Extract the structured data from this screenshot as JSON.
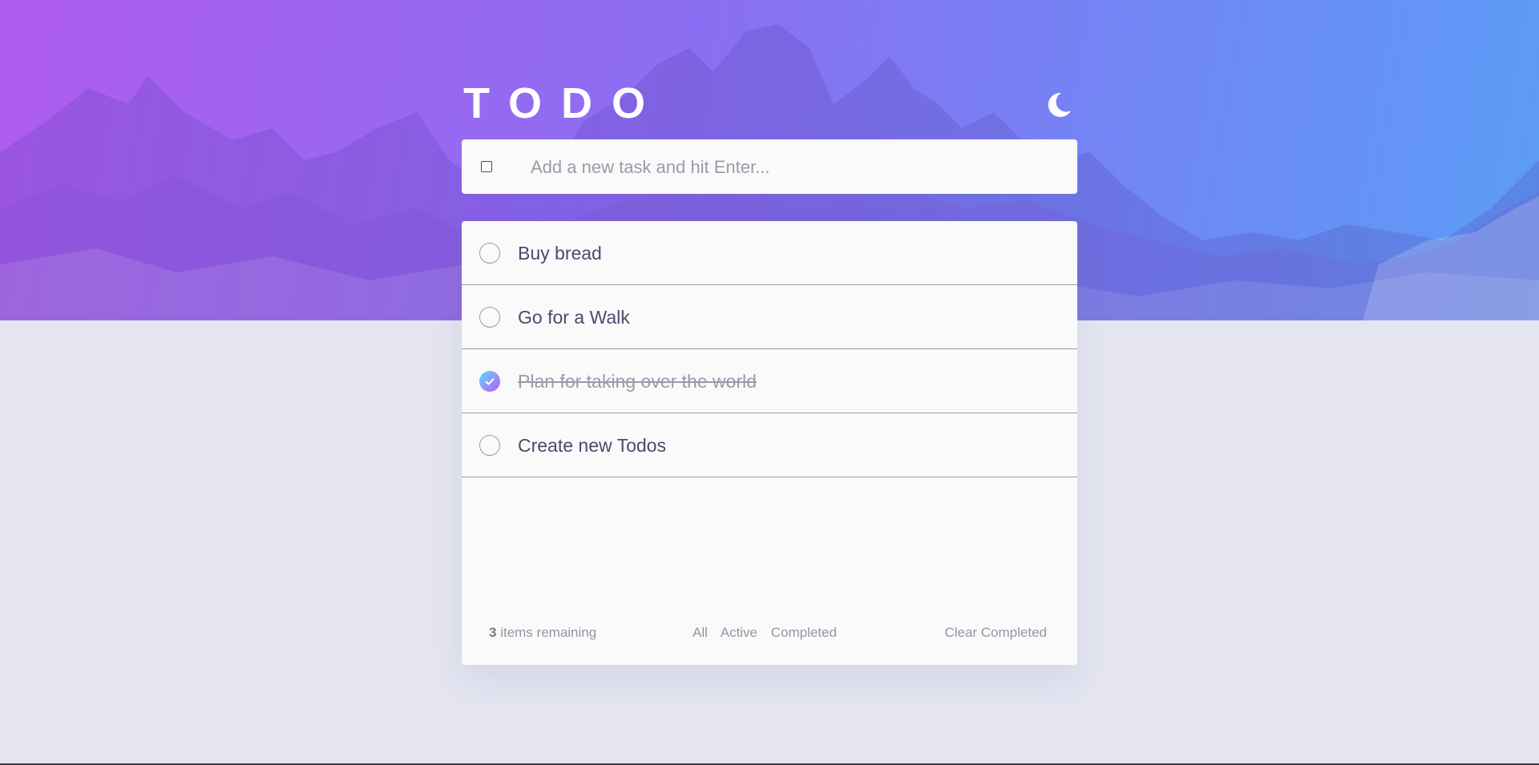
{
  "app": {
    "title": "TODO",
    "theme_toggle_icon": "moon-icon"
  },
  "new_task": {
    "placeholder": "Add a new task and hit Enter...",
    "value": ""
  },
  "todos": [
    {
      "text": "Buy bread",
      "completed": false
    },
    {
      "text": "Go for a Walk",
      "completed": false
    },
    {
      "text": "Plan for taking over the world",
      "completed": true
    },
    {
      "text": "Create new Todos",
      "completed": false
    }
  ],
  "footer": {
    "remaining_count": "3",
    "remaining_label": "items remaining",
    "filters": [
      "All",
      "Active",
      "Completed"
    ],
    "clear_label": "Clear Completed"
  },
  "colors": {
    "gradient_start": "#57ddff",
    "gradient_end": "#c058f3",
    "page_background": "#e4e5f1",
    "card_background": "#fafafa",
    "text": "#494c6b",
    "muted": "#9a9ba8"
  }
}
